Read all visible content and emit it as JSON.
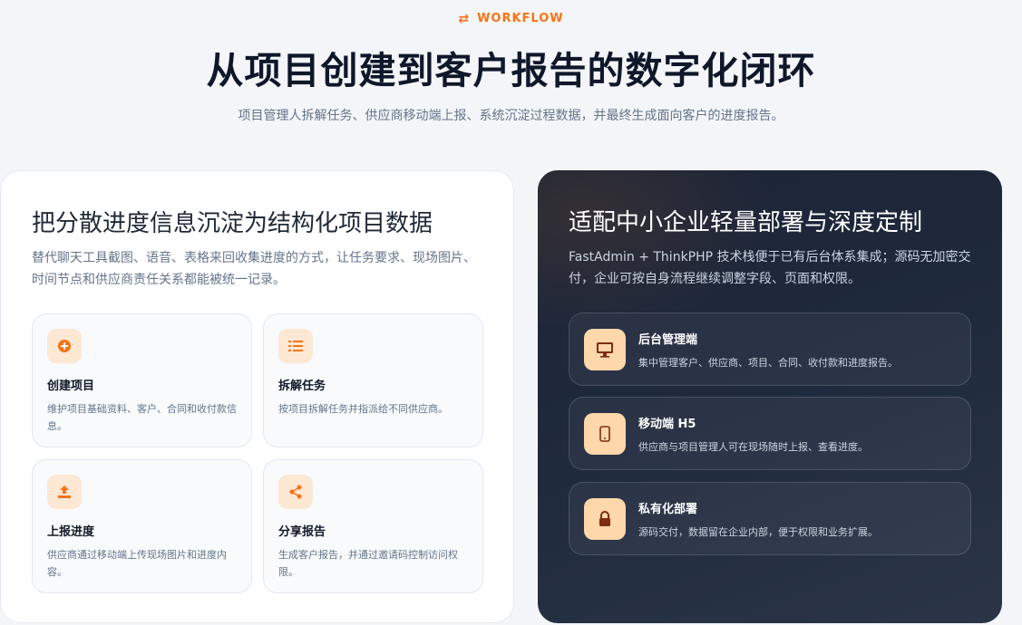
{
  "header": {
    "eyebrow": "WORKFLOW",
    "eyebrow_icon": "swap-arrows-icon",
    "title": "从项目创建到客户报告的数字化闭环",
    "subtitle": "项目管理人拆解任务、供应商移动端上报、系统沉淀过程数据，并最终生成面向客户的进度报告。"
  },
  "left_panel": {
    "title": "把分散进度信息沉淀为结构化项目数据",
    "description": "替代聊天工具截图、语音、表格来回收集进度的方式，让任务要求、现场图片、时间节点和供应商责任关系都能被统一记录。",
    "cards": [
      {
        "icon": "plus-circle-icon",
        "title": "创建项目",
        "desc": "维护项目基础资料、客户、合同和收付款信息。"
      },
      {
        "icon": "list-icon",
        "title": "拆解任务",
        "desc": "按项目拆解任务并指派给不同供应商。"
      },
      {
        "icon": "upload-icon",
        "title": "上报进度",
        "desc": "供应商通过移动端上传现场图片和进度内容。"
      },
      {
        "icon": "share-icon",
        "title": "分享报告",
        "desc": "生成客户报告，并通过邀请码控制访问权限。"
      }
    ]
  },
  "right_panel": {
    "title": "适配中小企业轻量部署与深度定制",
    "description": "FastAdmin + ThinkPHP 技术栈便于已有后台体系集成；源码无加密交付，企业可按自身流程继续调整字段、页面和权限。",
    "features": [
      {
        "icon": "monitor-icon",
        "title": "后台管理端",
        "desc": "集中管理客户、供应商、项目、合同、收付款和进度报告。"
      },
      {
        "icon": "mobile-icon",
        "title": "移动端 H5",
        "desc": "供应商与项目管理人可在现场随时上报、查看进度。"
      },
      {
        "icon": "lock-icon",
        "title": "私有化部署",
        "desc": "源码交付，数据留在企业内部，便于权限和业务扩展。"
      }
    ]
  },
  "colors": {
    "accent": "#f97316",
    "icon_bg_light": "#fde8d4",
    "icon_bg_dark_panel": "#fed7aa",
    "dark_panel": "#1f2739"
  }
}
